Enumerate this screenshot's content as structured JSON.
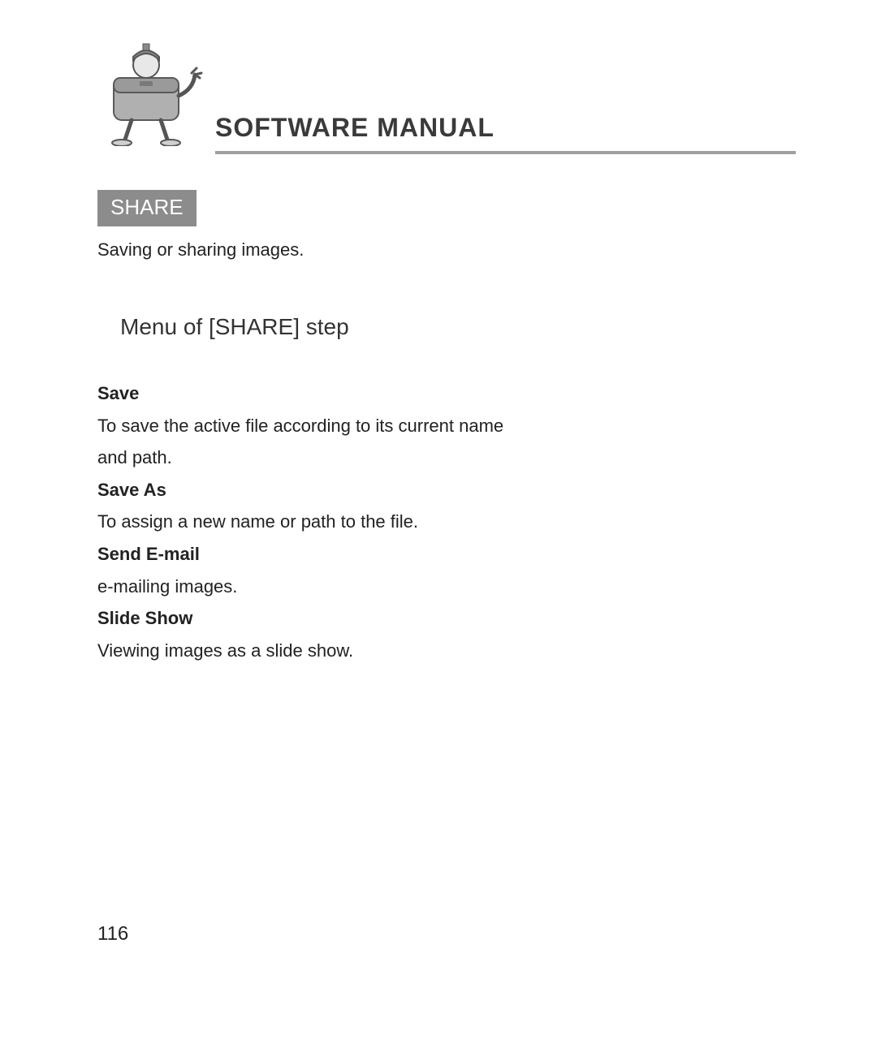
{
  "header": {
    "title": "SOFTWARE MANUAL"
  },
  "section": {
    "label": "SHARE",
    "description": "Saving or sharing images."
  },
  "sub_heading": "Menu of [SHARE] step",
  "items": [
    {
      "term": "Save",
      "desc": "To save the active file according to its current name and path."
    },
    {
      "term": "Save As",
      "desc": "To assign a new name or path to the file."
    },
    {
      "term": "Send E-mail",
      "desc": "e-mailing images."
    },
    {
      "term": "Slide Show",
      "desc": "Viewing images as a slide show."
    }
  ],
  "page_number": "116"
}
